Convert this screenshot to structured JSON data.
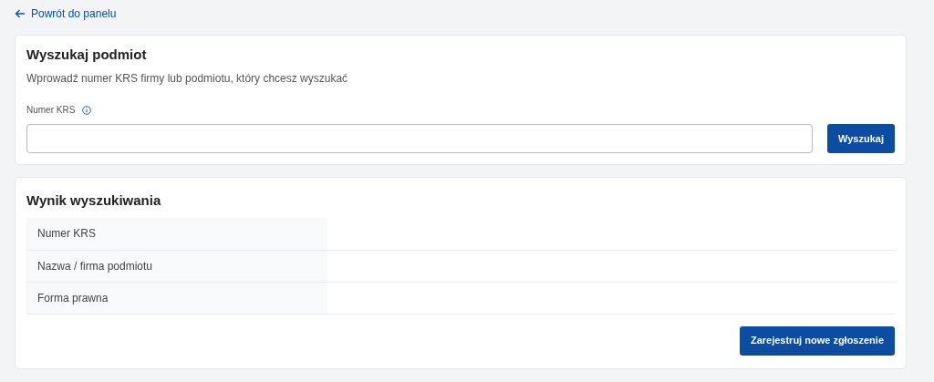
{
  "back_link": {
    "label": "Powrót do panelu"
  },
  "search_card": {
    "title": "Wyszukaj podmiot",
    "description": "Wprowadź numer KRS firmy lub podmiotu, który chcesz wyszukać",
    "field_label": "Numer KRS",
    "button": "Wyszukaj"
  },
  "result_card": {
    "title": "Wynik wyszukiwania",
    "rows": [
      {
        "label": "Numer KRS"
      },
      {
        "label": "Nazwa / firma podmiotu"
      },
      {
        "label": "Forma prawna"
      }
    ],
    "button": "Zarejestruj nowe zgłoszenie"
  }
}
